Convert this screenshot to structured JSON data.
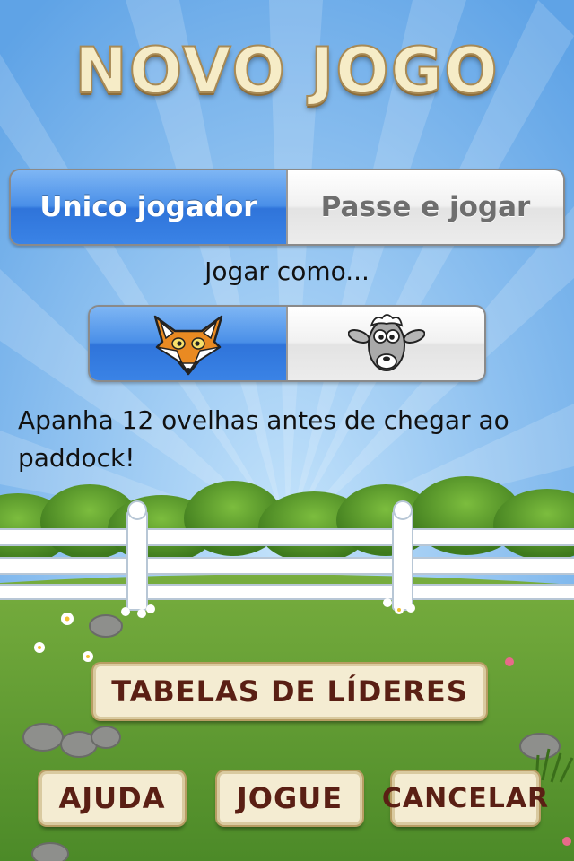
{
  "title": "NOVO JOGO",
  "mode_selector": {
    "options": [
      {
        "label": "Unico jogador",
        "selected": true
      },
      {
        "label": "Passe e jogar",
        "selected": false
      }
    ]
  },
  "play_as": {
    "label": "Jogar como...",
    "options": [
      {
        "icon": "fox-icon",
        "selected": true
      },
      {
        "icon": "sheep-icon",
        "selected": false
      }
    ]
  },
  "description": "Apanha 12 ovelhas antes de chegar ao paddock!",
  "buttons": {
    "leaderboards": "TABELAS DE LÍDERES",
    "help": "AJUDA",
    "play": "JOGUE",
    "cancel": "CANCELAR"
  },
  "colors": {
    "sky": "#7bb6ec",
    "grass": "#5f9c33",
    "selected_segment": "#3a83e6",
    "button_face": "#f4ecd2",
    "button_text": "#5a1f14"
  }
}
